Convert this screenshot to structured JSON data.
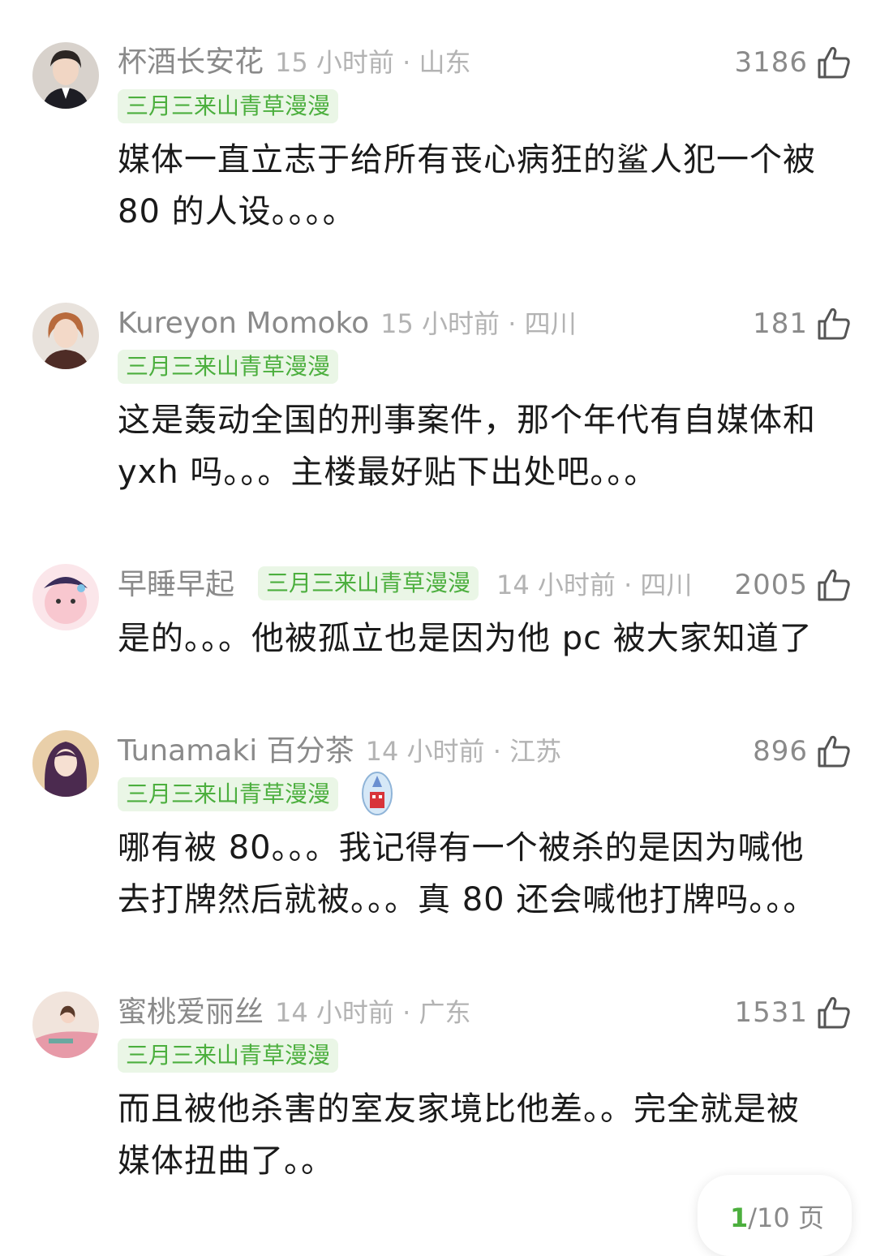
{
  "comments": [
    {
      "username": "杯酒长安花",
      "time": "15 小时前",
      "location": "山东",
      "likes": "3186",
      "badge": "三月三来山青草漫漫",
      "text_lines": [
        "媒体一直立志于给所有丧心病狂的鲨人犯一个被",
        "80 的人设。。。。"
      ]
    },
    {
      "username": "Kureyon Momoko",
      "time": "15 小时前",
      "location": "四川",
      "likes": "181",
      "badge": "三月三来山青草漫漫",
      "text_lines": [
        "这是轰动全国的刑事案件，那个年代有自媒体和",
        "yxh 吗。。。主楼最好贴下出处吧。。。"
      ]
    },
    {
      "username": "早睡早起",
      "time": "14 小时前",
      "location": "四川",
      "likes": "2005",
      "badge": "三月三来山青草漫漫",
      "text_lines": [
        "是的。。。他被孤立也是因为他 pc 被大家知道了"
      ]
    },
    {
      "username": "Tunamaki 百分茶",
      "time": "14 小时前",
      "location": "江苏",
      "likes": "896",
      "badge": "三月三来山青草漫漫",
      "text_lines": [
        "哪有被 80。。。我记得有一个被杀的是因为喊他",
        "去打牌然后就被。。。真 80 还会喊他打牌吗。。。"
      ]
    },
    {
      "username": "蜜桃爱丽丝",
      "time": "14 小时前",
      "location": "广东",
      "likes": "1531",
      "badge": "三月三来山青草漫漫",
      "text_lines": [
        "而且被他杀害的室友家境比他差。。完全就是被",
        "媒体扭曲了。。"
      ]
    }
  ],
  "pager": {
    "current": "1",
    "total": "/10 页"
  },
  "colors": {
    "accent": "#4caf3e",
    "badge_bg": "#eaf6e6",
    "meta": "#8a8a8a",
    "text": "#1a1a1a"
  },
  "icons": {
    "like": "thumbs-up-icon"
  }
}
